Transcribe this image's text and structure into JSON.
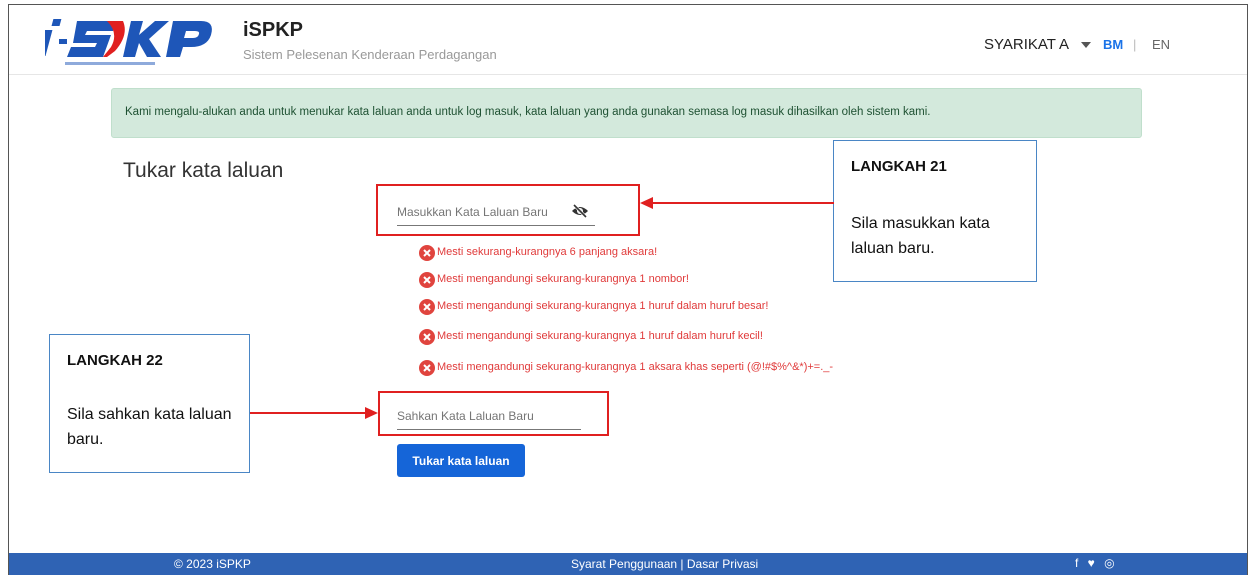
{
  "header": {
    "app_name": "iSPKP",
    "app_subtitle": "Sistem Pelesenan Kenderaan Perdagangan",
    "logo_text": "iSPKP",
    "company": "SYARIKAT A",
    "lang_bm": "BM",
    "lang_sep": "|",
    "lang_en": "EN"
  },
  "alert": {
    "text": "Kami mengalu-alukan anda untuk menukar kata laluan anda untuk log masuk, kata laluan yang anda gunakan semasa log masuk dihasilkan oleh sistem kami."
  },
  "form": {
    "title": "Tukar kata laluan",
    "new_password_placeholder": "Masukkan Kata Laluan Baru",
    "confirm_password_placeholder": "Sahkan Kata Laluan Baru",
    "submit_label": "Tukar kata laluan",
    "rules": [
      "Mesti sekurang-kurangnya 6 panjang aksara!",
      "Mesti mengandungi sekurang-kurangnya 1 nombor!",
      "Mesti mengandungi sekurang-kurangnya 1 huruf dalam huruf besar!",
      "Mesti mengandungi sekurang-kurangnya 1 huruf dalam huruf kecil!",
      "Mesti mengandungi sekurang-kurangnya 1 aksara khas seperti (@!#$%^&*)+=._-"
    ]
  },
  "callouts": {
    "step21": {
      "title": "LANGKAH 21",
      "desc": "Sila masukkan kata laluan baru."
    },
    "step22": {
      "title": "LANGKAH 22",
      "desc": "Sila sahkan kata laluan baru."
    }
  },
  "footer": {
    "copyright": "© 2023 iSPKP",
    "links": "Syarat Penggunaan | Dasar Privasi",
    "social": "f ♥ ◎"
  },
  "colors": {
    "primary": "#1565d8",
    "footer": "#2f63b4",
    "alert_bg": "#d3e9dc",
    "error": "#e03a3a",
    "highlight": "#e02020",
    "callout_border": "#4a86c5"
  }
}
